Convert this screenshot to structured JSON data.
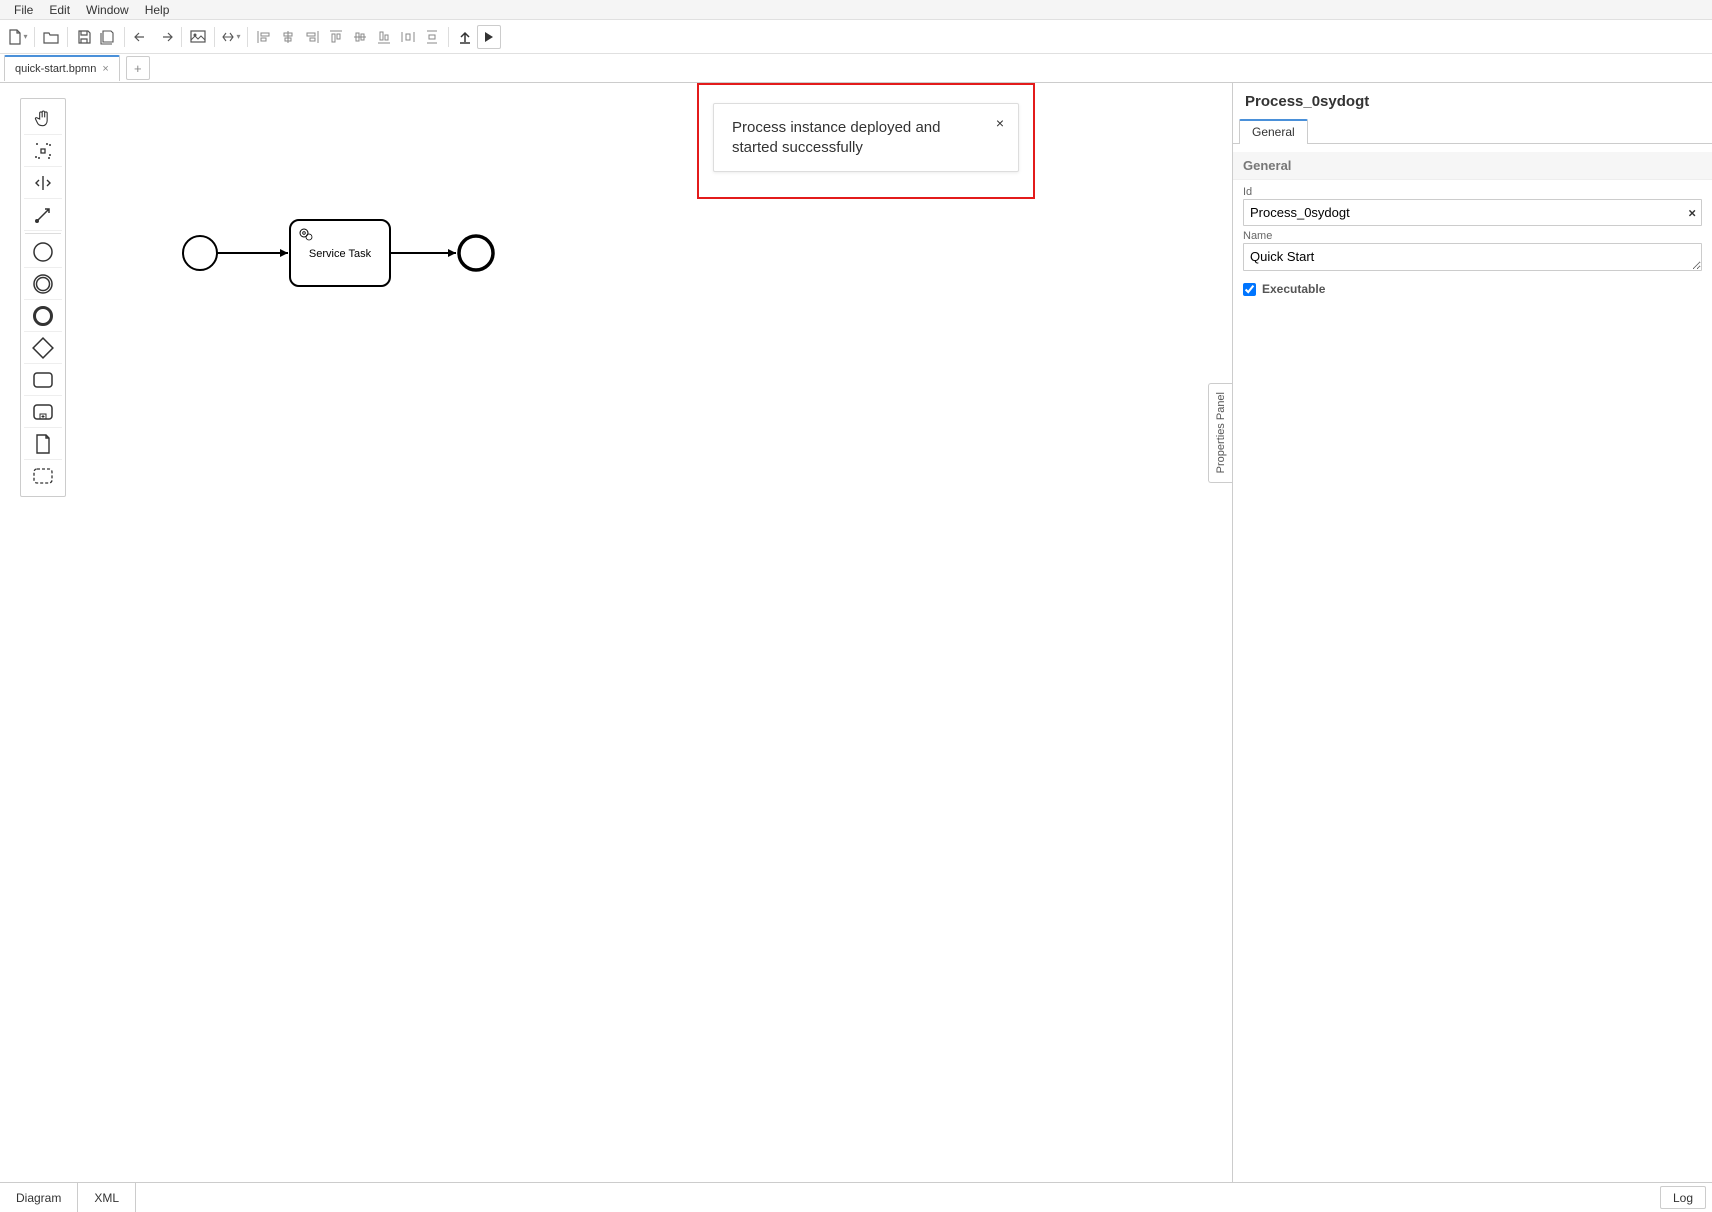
{
  "menubar": {
    "file": "File",
    "edit": "Edit",
    "window": "Window",
    "help": "Help"
  },
  "tabs": {
    "active": "quick-start.bpmn"
  },
  "notification": {
    "text": "Process instance deployed and started successfully"
  },
  "diagram": {
    "task_label": "Service Task"
  },
  "properties": {
    "title": "Process_0sydogt",
    "tab_general": "General",
    "group_general": "General",
    "id_label": "Id",
    "id_value": "Process_0sydogt",
    "name_label": "Name",
    "name_value": "Quick Start",
    "executable_label": "Executable",
    "toggle_label": "Properties Panel"
  },
  "bottombar": {
    "diagram": "Diagram",
    "xml": "XML",
    "log": "Log"
  }
}
